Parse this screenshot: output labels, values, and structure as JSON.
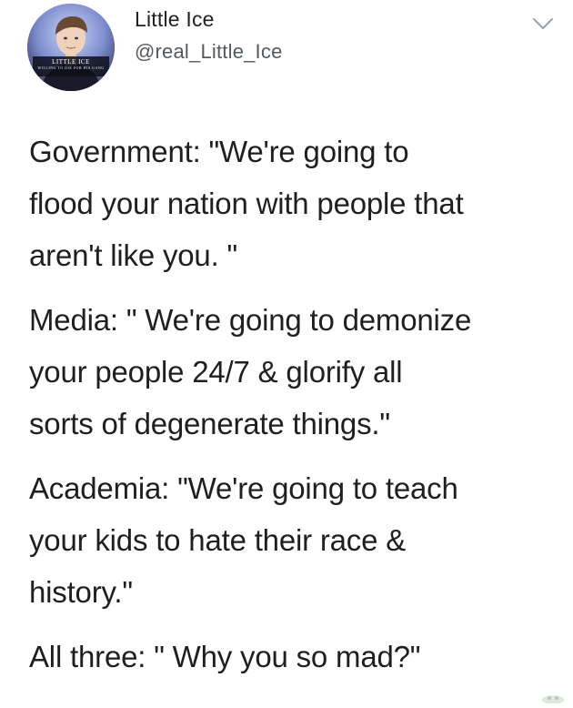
{
  "author": {
    "display_name": "Little Ice",
    "handle": "@real_Little_Ice",
    "avatar_caption": "LITTLE ICE",
    "avatar_caption_sub": "WILLING TO DIE FOR HIS GANG"
  },
  "menu": {
    "icon": "chevron-down-icon"
  },
  "tweet": {
    "paragraphs": [
      "Government: \"We're going to\nflood your nation with people that\naren't like you. \"",
      "Media: \" We're going to demonize\nyour people 24/7 & glorify all\nsorts of degenerate things.\"",
      "Academia: \"We're going to teach\nyour kids to hate their race &\nhistory.\"",
      "All three: \" Why you so mad?\""
    ]
  },
  "colors": {
    "text": "#1f1f1f",
    "handle": "#555a5f",
    "background": "#ffffff",
    "caret": "#9aa3ab"
  }
}
